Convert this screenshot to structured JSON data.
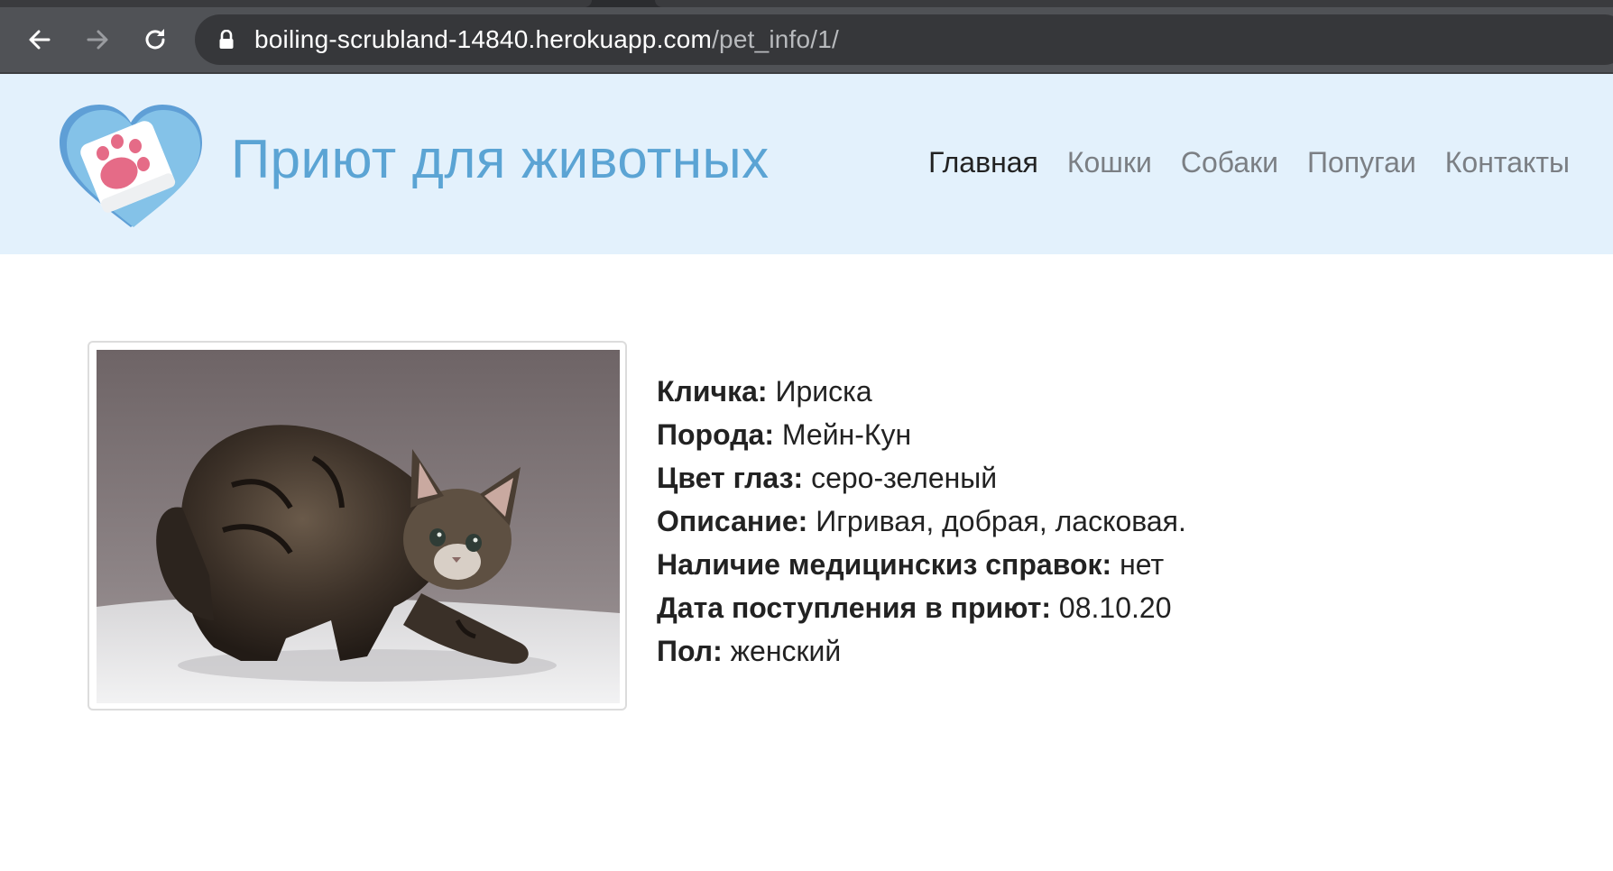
{
  "browser": {
    "url_host": "boiling-scrubland-14840.herokuapp.com",
    "url_path": "/pet_info/1/",
    "icons": {
      "back": "arrow-left-icon",
      "forward": "arrow-right-icon",
      "reload": "reload-icon",
      "secure": "lock-icon"
    }
  },
  "site": {
    "title": "Приют для животных",
    "logo": "heart-paw-logo",
    "nav": [
      {
        "label": "Главная",
        "active": true
      },
      {
        "label": "Кошки",
        "active": false
      },
      {
        "label": "Собаки",
        "active": false
      },
      {
        "label": "Попугаи",
        "active": false
      },
      {
        "label": "Контакты",
        "active": false
      }
    ],
    "colors": {
      "header_bg": "#e3f1fc",
      "title": "#5ba4d4",
      "nav_inactive": "#7b7f84",
      "nav_active": "#222222"
    }
  },
  "pet": {
    "photo": "tabby-kitten-photo",
    "fields": [
      {
        "label": "Кличка:",
        "value": "Ириска"
      },
      {
        "label": "Порода:",
        "value": "Мейн-Кун"
      },
      {
        "label": "Цвет глаз:",
        "value": "серо-зеленый"
      },
      {
        "label": "Описание:",
        "value": "Игривая, добрая, ласковая."
      },
      {
        "label": "Наличие медицинскиз справок:",
        "value": "нет"
      },
      {
        "label": "Дата поступления в приют:",
        "value": "08.10.20"
      },
      {
        "label": "Пол:",
        "value": "женский"
      }
    ]
  }
}
